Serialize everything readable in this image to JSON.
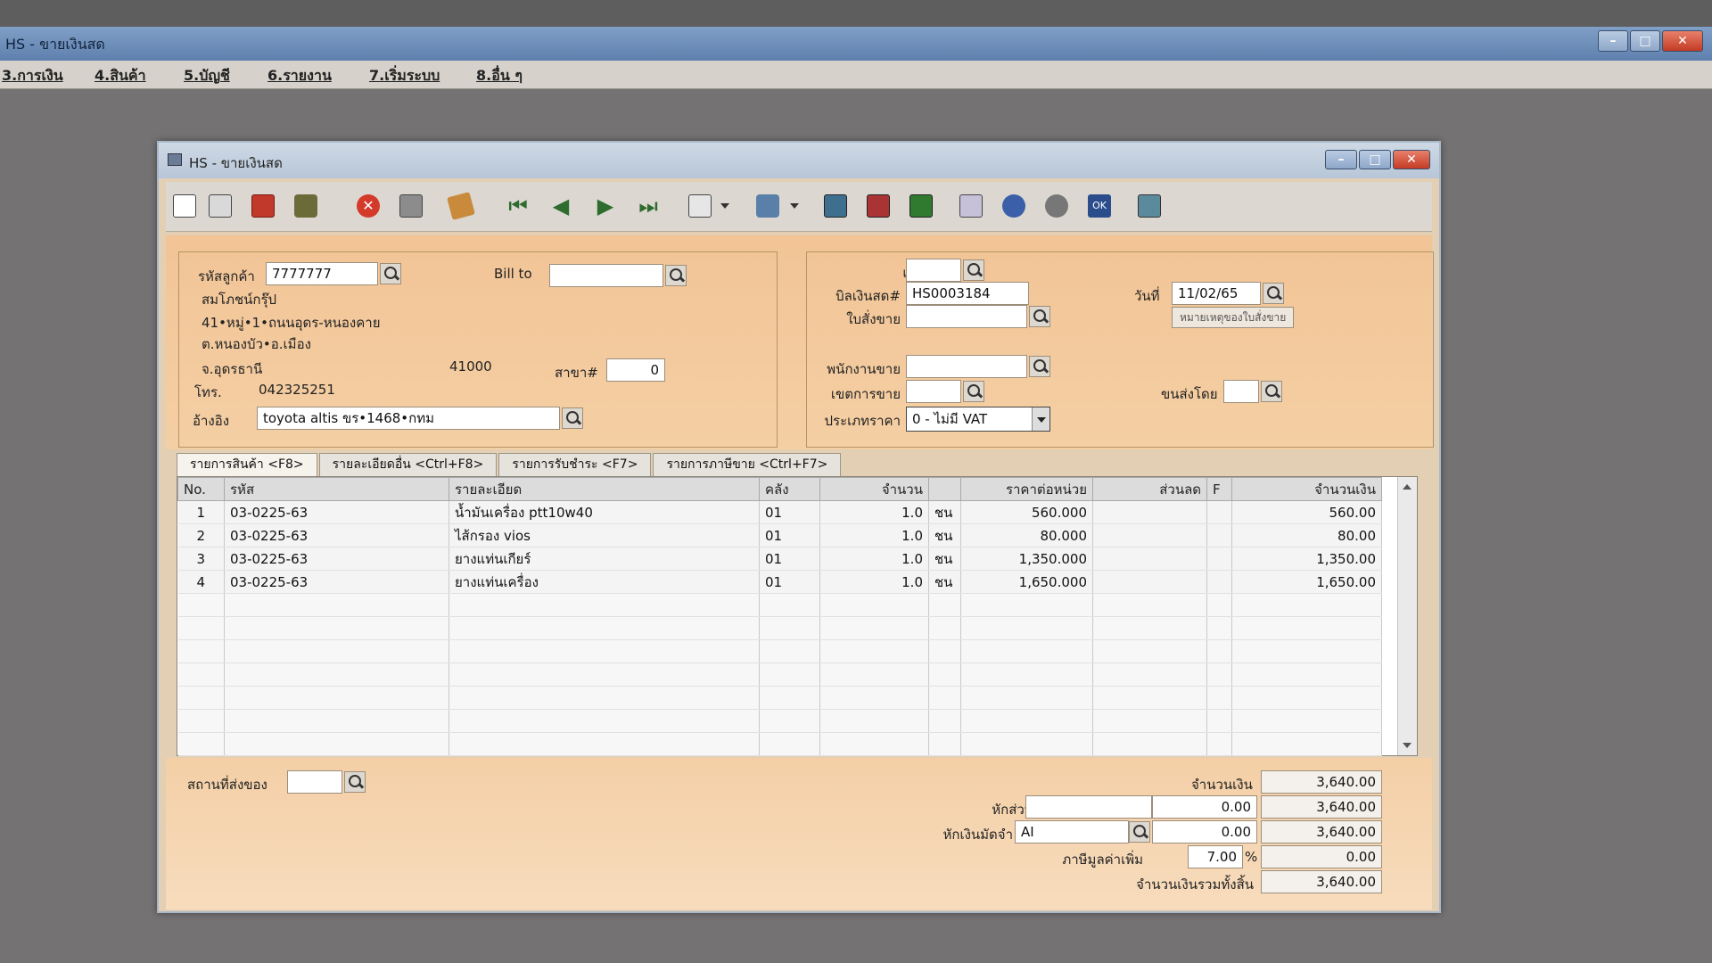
{
  "app": {
    "title": "HS - ขายเงินสด",
    "menu": [
      "3.การเงิน",
      "4.สินค้า",
      "5.บัญชี",
      "6.รายงาน",
      "7.เริ่มระบบ",
      "8.อื่น ๆ"
    ]
  },
  "window": {
    "title": "HS - ขายเงินสด"
  },
  "toolbar": {
    "icons": [
      "new-icon",
      "edit-icon",
      "void-icon",
      "delete-icon",
      "cancel-icon",
      "save-icon",
      "copy-icon",
      "first-record-icon",
      "prev-record-icon",
      "next-record-icon",
      "last-record-icon",
      "search-icon",
      "print-icon",
      "calc-icon",
      "form-icon",
      "cash-icon",
      "layout-icon",
      "approve-icon",
      "tools-icon",
      "ok-icon",
      "export-icon"
    ]
  },
  "customer": {
    "code_label": "รหัสลูกค้า",
    "code": "7777777",
    "name": "สมโภชน์กรุ๊ป",
    "address1": "41•หมู่•1•ถนนอุดร-หนองคาย",
    "address2": "ต.หนองบัว•อ.เมือง",
    "province": "จ.อุดรธานี",
    "zip": "41000",
    "branch_label": "สาขา#",
    "branch": "0",
    "phone_label": "โทร.",
    "phone": "042325251",
    "ref_label": "อ้างอิง",
    "ref": "toyota altis ขร•1468•กทม",
    "bill_to_label": "Bill to",
    "bill_to": ""
  },
  "doc": {
    "dept_label": "แผนก",
    "dept": "",
    "invoice_label": "บิลเงินสด#",
    "invoice": "HS0003184",
    "so_label": "ใบสั่งขาย",
    "so": "",
    "date_label": "วันที่",
    "date": "11/02/65",
    "so_note_button": "หมายเหตุของใบสั่งขาย",
    "salesman_label": "พนักงานขาย",
    "salesman": "",
    "area_label": "เขตการขาย",
    "area": "",
    "ship_by_label": "ขนส่งโดย",
    "ship_by": "",
    "price_type_label": "ประเภทราคา",
    "price_type": "0 - ไม่มี VAT"
  },
  "tabs": [
    "รายการสินค้า <F8>",
    "รายละเอียดอื่น <Ctrl+F8>",
    "รายการรับชำระ <F7>",
    "รายการภาษีขาย <Ctrl+F7>"
  ],
  "grid": {
    "headers": [
      "No.",
      "รหัส",
      "รายละเอียด",
      "คลัง",
      "จำนวน",
      "",
      "ราคาต่อหน่วย",
      "ส่วนลด",
      "F",
      "จำนวนเงิน"
    ],
    "rows": [
      {
        "no": "1",
        "code": "03-0225-63",
        "desc": "น้ำมันเครื่อง ptt10w40",
        "wh": "01",
        "qty": "1.0",
        "unit": "ชน",
        "price": "560.000",
        "disc": "",
        "f": "",
        "amount": "560.00"
      },
      {
        "no": "2",
        "code": "03-0225-63",
        "desc": "ไส้กรอง vios",
        "wh": "01",
        "qty": "1.0",
        "unit": "ชน",
        "price": "80.000",
        "disc": "",
        "f": "",
        "amount": "80.00"
      },
      {
        "no": "3",
        "code": "03-0225-63",
        "desc": "ยางแท่นเกียร์",
        "wh": "01",
        "qty": "1.0",
        "unit": "ชน",
        "price": "1,350.000",
        "disc": "",
        "f": "",
        "amount": "1,350.00"
      },
      {
        "no": "4",
        "code": "03-0225-63",
        "desc": "ยางแท่นเครื่อง",
        "wh": "01",
        "qty": "1.0",
        "unit": "ชน",
        "price": "1,650.000",
        "disc": "",
        "f": "",
        "amount": "1,650.00"
      }
    ]
  },
  "totals": {
    "ship_place_label": "สถานที่ส่งของ",
    "ship_place": "",
    "amount_label": "จำนวนเงิน",
    "amount": "3,640.00",
    "discount_label": "หักส่วนลด",
    "discount_text": "",
    "discount": "0.00",
    "after_discount": "3,640.00",
    "deposit_label": "หักเงินมัดจำ",
    "deposit_code": "AI",
    "deposit": "0.00",
    "after_deposit": "3,640.00",
    "vat_label": "ภาษีมูลค่าเพิ่ม",
    "vat_rate": "7.00",
    "vat_pct": "%",
    "vat": "0.00",
    "grand_label": "จำนวนเงินรวมทั้งสิ้น",
    "grand": "3,640.00"
  }
}
